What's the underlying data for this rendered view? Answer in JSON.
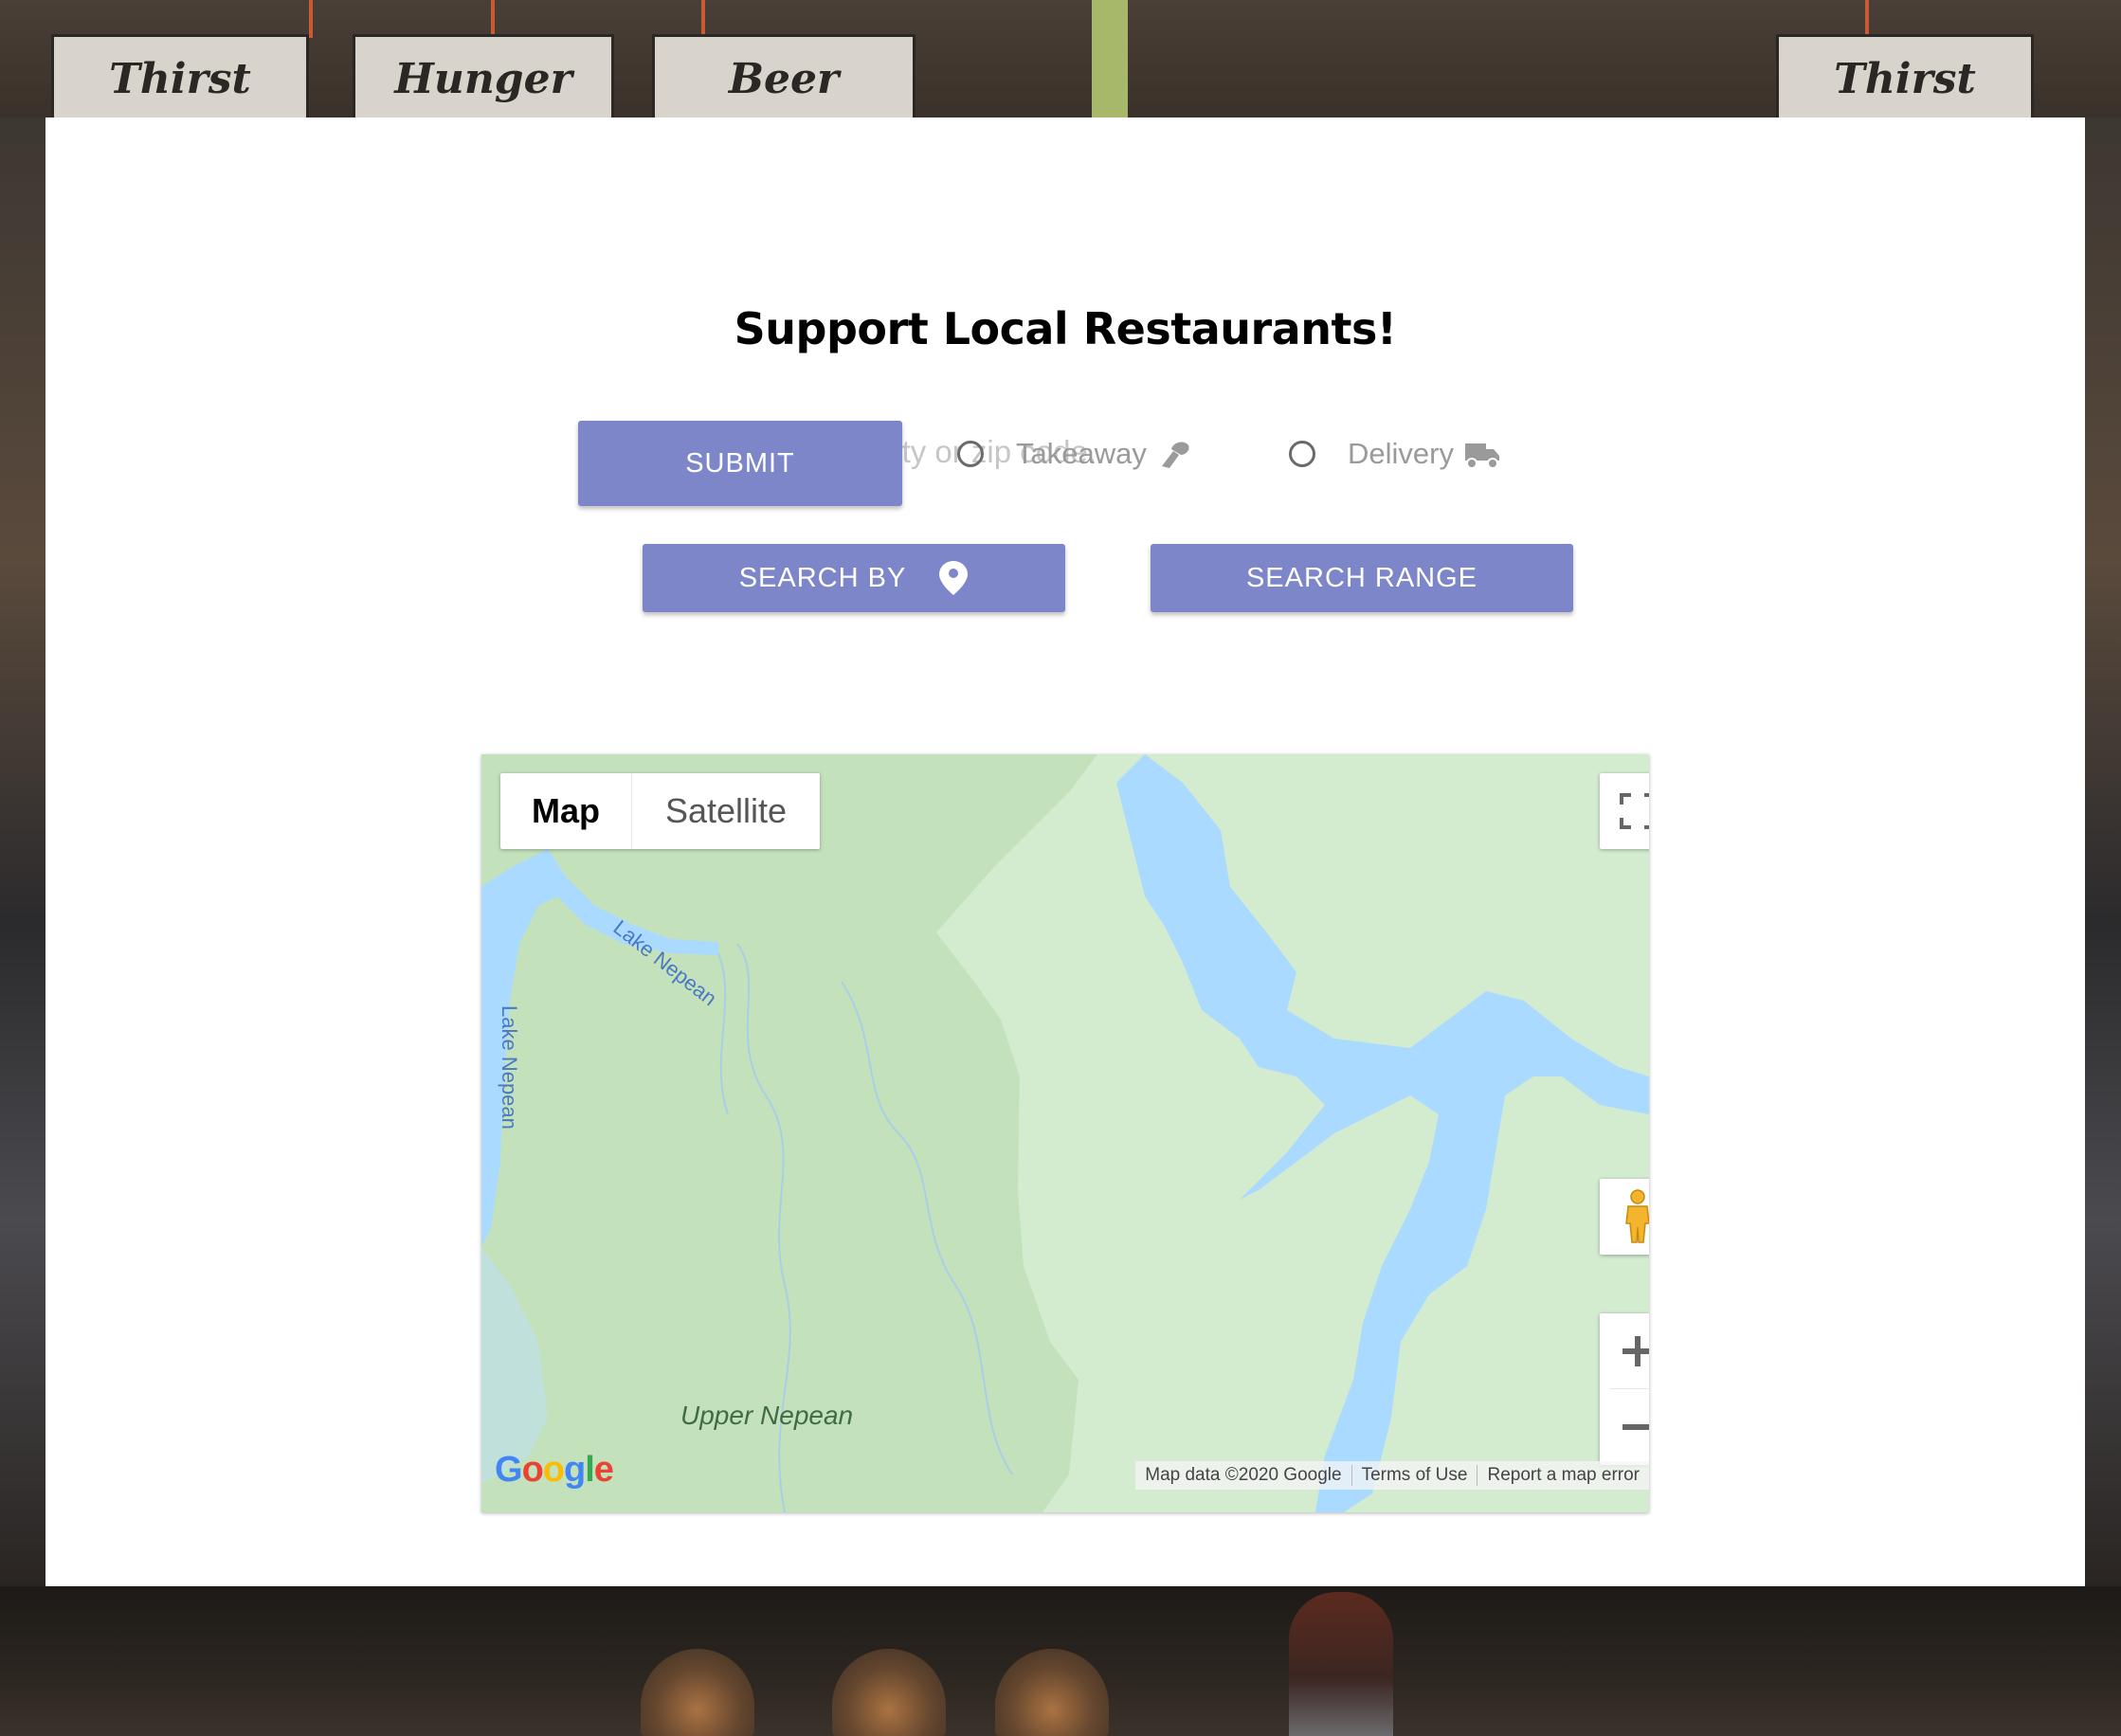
{
  "page": {
    "title": "Support Local Restaurants!"
  },
  "search": {
    "placeholder": "Search by city or zip code...",
    "value": ""
  },
  "buttons": {
    "submit": "SUBMIT",
    "search_by": "SEARCH BY",
    "search_range": "SEARCH RANGE"
  },
  "filters": [
    {
      "label": "Takeaway",
      "icon": "takeaway-icon",
      "checked": false
    },
    {
      "label": "Delivery",
      "icon": "truck-icon",
      "checked": false
    }
  ],
  "map": {
    "map_type_options": [
      "Map",
      "Satellite"
    ],
    "selected_map_type": "Map",
    "labels": [
      "Lake Nepean",
      "Lake Nepean",
      "Upper Nepean"
    ],
    "attribution": [
      "Map data ©2020 Google",
      "Terms of Use",
      "Report a map error"
    ],
    "logo_letters": [
      "G",
      "o",
      "o",
      "g",
      "l",
      "e"
    ]
  },
  "colors": {
    "accent": "#7c86c9",
    "map_land": "#c3e2bb",
    "map_land_light": "#d3ecd0",
    "map_water": "#aadaff"
  }
}
